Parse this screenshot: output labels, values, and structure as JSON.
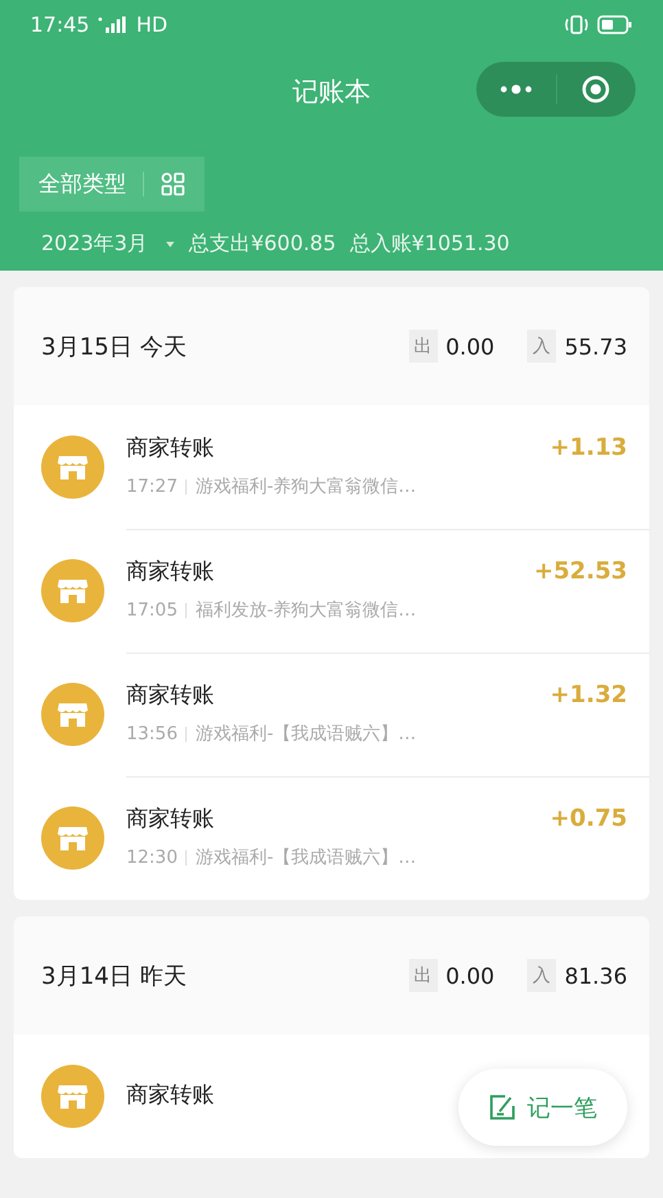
{
  "status_bar": {
    "time": "17:45",
    "network": "HD"
  },
  "nav": {
    "title": "记账本"
  },
  "filter": {
    "label": "全部类型"
  },
  "summary": {
    "month": "2023年3月",
    "expense": "总支出¥600.85",
    "income": "总入账¥1051.30"
  },
  "days": [
    {
      "date": "3月15日 今天",
      "out_label": "出",
      "out": "0.00",
      "in_label": "入",
      "in": "55.73",
      "records": [
        {
          "title": "商家转账",
          "time": "17:27",
          "note": "游戏福利-养狗大富翁微信…",
          "amount": "+1.13"
        },
        {
          "title": "商家转账",
          "time": "17:05",
          "note": "福利发放-养狗大富翁微信…",
          "amount": "+52.53"
        },
        {
          "title": "商家转账",
          "time": "13:56",
          "note": "游戏福利-【我成语贼六】…",
          "amount": "+1.32"
        },
        {
          "title": "商家转账",
          "time": "12:30",
          "note": "游戏福利-【我成语贼六】…",
          "amount": "+0.75"
        }
      ]
    },
    {
      "date": "3月14日 昨天",
      "out_label": "出",
      "out": "0.00",
      "in_label": "入",
      "in": "81.36",
      "records": [
        {
          "title": "商家转账"
        }
      ]
    }
  ],
  "fab": {
    "label": "记一笔"
  }
}
